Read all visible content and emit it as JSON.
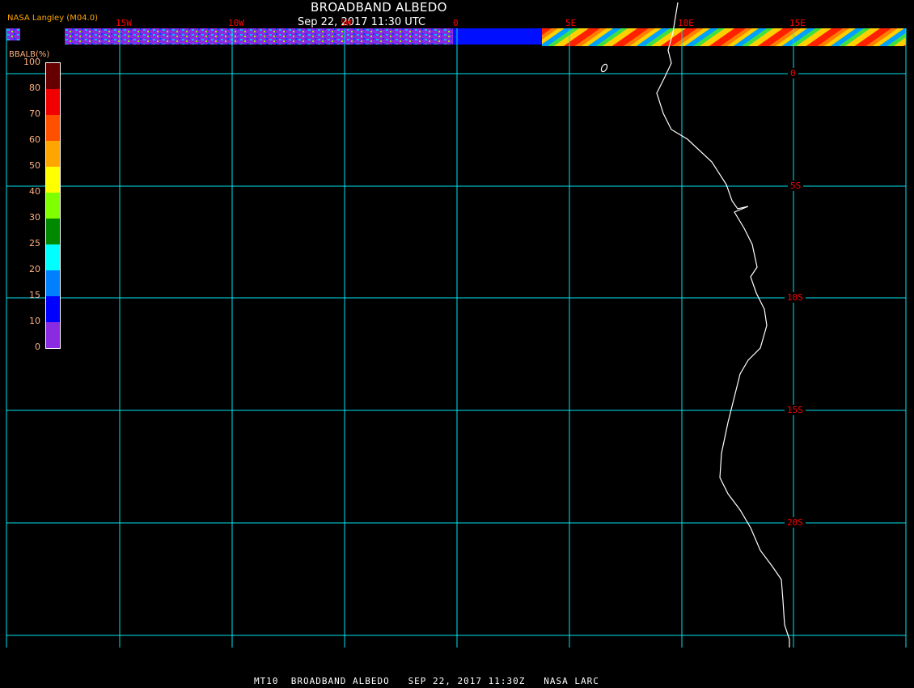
{
  "header": {
    "title": "BROADBAND ALBEDO",
    "subtitle": "Sep 22, 2017 11:30 UTC",
    "agency": "NASA Langley (M04.0)"
  },
  "footer": "MT10  BROADBAND ALBEDO   SEP 22, 2017 11:30Z   NASA LARC",
  "longitude_labels": [
    "15W",
    "10W",
    "5W",
    "0",
    "5E",
    "10E",
    "15E"
  ],
  "latitude_labels": [
    "0",
    "5S",
    "10S",
    "15S",
    "20S"
  ],
  "legend": {
    "title": "BBALB(%)",
    "ticks": [
      "0",
      "10",
      "15",
      "20",
      "25",
      "30",
      "40",
      "50",
      "60",
      "70",
      "80",
      "100"
    ],
    "colors": [
      "#8a2be2",
      "#0000ff",
      "#0080ff",
      "#00ffff",
      "#008800",
      "#80ff00",
      "#ffff00",
      "#ffa500",
      "#ff5000",
      "#f00000",
      "#660000"
    ]
  },
  "colors": {
    "grid": "#00e5ee",
    "coast": "#ffffff",
    "label": "#ff0000"
  }
}
